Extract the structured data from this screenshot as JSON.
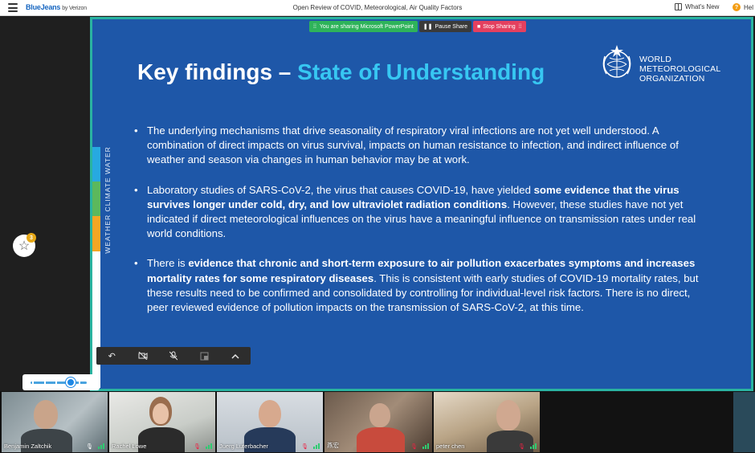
{
  "app": {
    "brand": "BlueJeans",
    "brand_suffix": "by Verizon",
    "window_title": "Open Review of COVID, Meteorological, Air Quality Factors",
    "whats_new": "What's New",
    "help": "Hel"
  },
  "share_bar": {
    "sharing_label": "You are sharing Microsoft PowerPoint",
    "pause_label": "Pause Share",
    "stop_label": "Stop Sharing"
  },
  "favorite": {
    "badge": "3"
  },
  "slide": {
    "title_part1": "Key findings –",
    "title_part2": "State of Understanding",
    "org_line1": "WORLD",
    "org_line2": "METEOROLOGICAL",
    "org_line3": "ORGANIZATION",
    "side_label": "WEATHER CLIMATE WATER",
    "colors": {
      "background": "#1e57a8",
      "highlight": "#37c7f2",
      "bar_water": "#27a9e1",
      "bar_climate": "#5cb85c",
      "bar_weather": "#f5a623",
      "bar_bottom": "#ffffff"
    },
    "bullets": [
      {
        "pre": "The underlying mechanisms that drive seasonality of respiratory viral infections are not yet well understood. A combination of direct impacts on virus survival, impacts on human resistance to infection, and indirect influence of weather and season via changes in human behavior may be at work.",
        "bold": "",
        "post": ""
      },
      {
        "pre": "Laboratory studies of SARS-CoV-2, the virus that causes COVID-19, have yielded ",
        "bold": "some evidence that the virus survives longer under cold, dry, and low ultraviolet radiation conditions",
        "post": ". However, these studies have not yet indicated if direct meteorological influences on the virus have a meaningful influence on transmission rates under real world conditions."
      },
      {
        "pre": "There is ",
        "bold": "evidence that chronic and short-term exposure to air pollution exacerbates symptoms and increases mortality rates for some respiratory diseases",
        "post": ". This is consistent with early studies of COVID-19 mortality rates, but these results need to be confirmed and consolidated by controlling for individual-level risk factors. There is no direct, peer reviewed evidence of pollution impacts on the transmission of SARS-CoV-2, at this time."
      }
    ]
  },
  "toolbar": {
    "icons": [
      "back-icon",
      "video-off-icon",
      "mic-off-icon",
      "layout-icon",
      "chevron-up-icon"
    ]
  },
  "volume": {
    "level": 0.7
  },
  "participants": [
    {
      "name": "Benjamin Zaltchik",
      "muted": false,
      "active": true
    },
    {
      "name": "Rachel Lowe",
      "muted": true,
      "active": false
    },
    {
      "name": "Juerg Luterbacher",
      "muted": true,
      "active": false
    },
    {
      "name": "燕宏",
      "muted": true,
      "active": false
    },
    {
      "name": "peter chen",
      "muted": true,
      "active": false
    }
  ]
}
